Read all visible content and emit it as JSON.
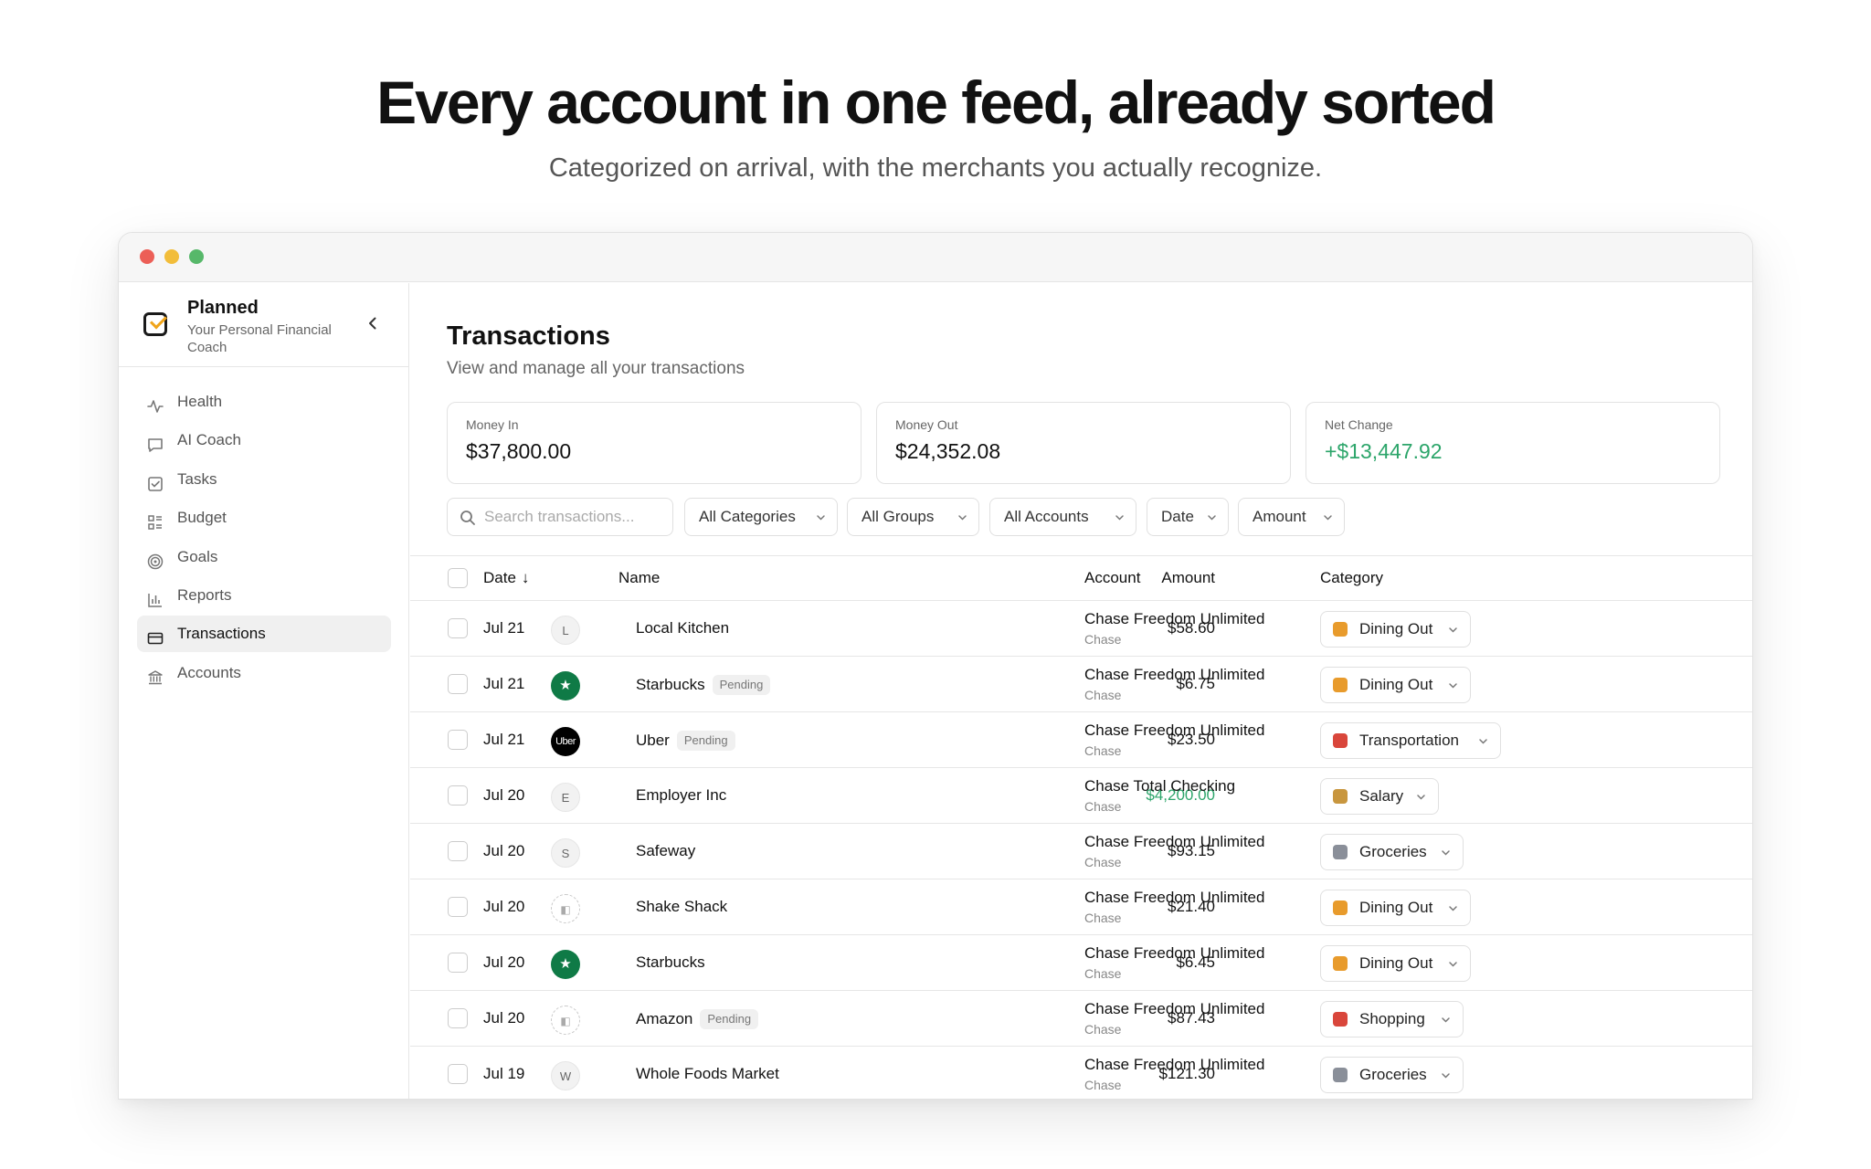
{
  "hero": {
    "title": "Every account in one feed, already sorted",
    "subtitle": "Categorized on arrival, with the merchants you actually recognize."
  },
  "sidebar": {
    "brand_name": "Planned",
    "brand_tagline": "Your Personal Financial Coach",
    "items": [
      {
        "label": "Health",
        "icon": "pulse-icon"
      },
      {
        "label": "AI Coach",
        "icon": "chat-icon"
      },
      {
        "label": "Tasks",
        "icon": "checkbox-icon"
      },
      {
        "label": "Budget",
        "icon": "list-icon"
      },
      {
        "label": "Goals",
        "icon": "target-icon"
      },
      {
        "label": "Reports",
        "icon": "bar-chart-icon"
      },
      {
        "label": "Transactions",
        "icon": "card-icon",
        "active": true
      },
      {
        "label": "Accounts",
        "icon": "bank-icon"
      }
    ]
  },
  "main": {
    "title": "Transactions",
    "subtitle": "View and manage all your transactions",
    "summary": [
      {
        "label": "Money In",
        "value": "$37,800.00"
      },
      {
        "label": "Money Out",
        "value": "$24,352.08"
      },
      {
        "label": "Net Change",
        "value": "+$13,447.92"
      }
    ],
    "search_placeholder": "Search transactions...",
    "filters": [
      "All Categories",
      "All Groups",
      "All Accounts",
      "Date",
      "Amount"
    ],
    "columns": {
      "date": "Date",
      "name": "Name",
      "amount": "Amount",
      "account": "Account",
      "category": "Category"
    },
    "pending_label": "Pending",
    "rows": [
      {
        "date": "Jul 21",
        "name": "Local Kitchen",
        "logo": "L",
        "pending": false,
        "amount": "$58.60",
        "account": "Chase Freedom Unlimited",
        "institution": "Chase",
        "category": "Dining Out"
      },
      {
        "date": "Jul 21",
        "name": "Starbucks",
        "logo": "starbucks",
        "pending": true,
        "amount": "$6.75",
        "account": "Chase Freedom Unlimited",
        "institution": "Chase",
        "category": "Dining Out"
      },
      {
        "date": "Jul 21",
        "name": "Uber",
        "logo": "Uber",
        "pending": true,
        "amount": "$23.50",
        "account": "Chase Freedom Unlimited",
        "institution": "Chase",
        "category": "Transportation"
      },
      {
        "date": "Jul 20",
        "name": "Employer Inc",
        "logo": "E",
        "pending": false,
        "amount": "$4,200.00",
        "income": true,
        "account": "Chase Total Checking",
        "institution": "Chase",
        "category": "Salary"
      },
      {
        "date": "Jul 20",
        "name": "Safeway",
        "logo": "S",
        "pending": false,
        "amount": "$93.15",
        "account": "Chase Freedom Unlimited",
        "institution": "Chase",
        "category": "Groceries"
      },
      {
        "date": "Jul 20",
        "name": "Shake Shack",
        "logo": "broken",
        "pending": false,
        "amount": "$21.40",
        "account": "Chase Freedom Unlimited",
        "institution": "Chase",
        "category": "Dining Out"
      },
      {
        "date": "Jul 20",
        "name": "Starbucks",
        "logo": "starbucks",
        "pending": false,
        "amount": "$6.45",
        "account": "Chase Freedom Unlimited",
        "institution": "Chase",
        "category": "Dining Out"
      },
      {
        "date": "Jul 20",
        "name": "Amazon",
        "logo": "broken",
        "pending": true,
        "amount": "$87.43",
        "account": "Chase Freedom Unlimited",
        "institution": "Chase",
        "category": "Shopping"
      },
      {
        "date": "Jul 19",
        "name": "Whole Foods Market",
        "logo": "W",
        "pending": false,
        "amount": "$121.30",
        "account": "Chase Freedom Unlimited",
        "institution": "Chase",
        "category": "Groceries"
      }
    ],
    "category_colors": {
      "Dining Out": "#e89b2c",
      "Transportation": "#d9463b",
      "Salary": "#c8963e",
      "Groceries": "#8a8f99",
      "Shopping": "#d9463b"
    }
  }
}
